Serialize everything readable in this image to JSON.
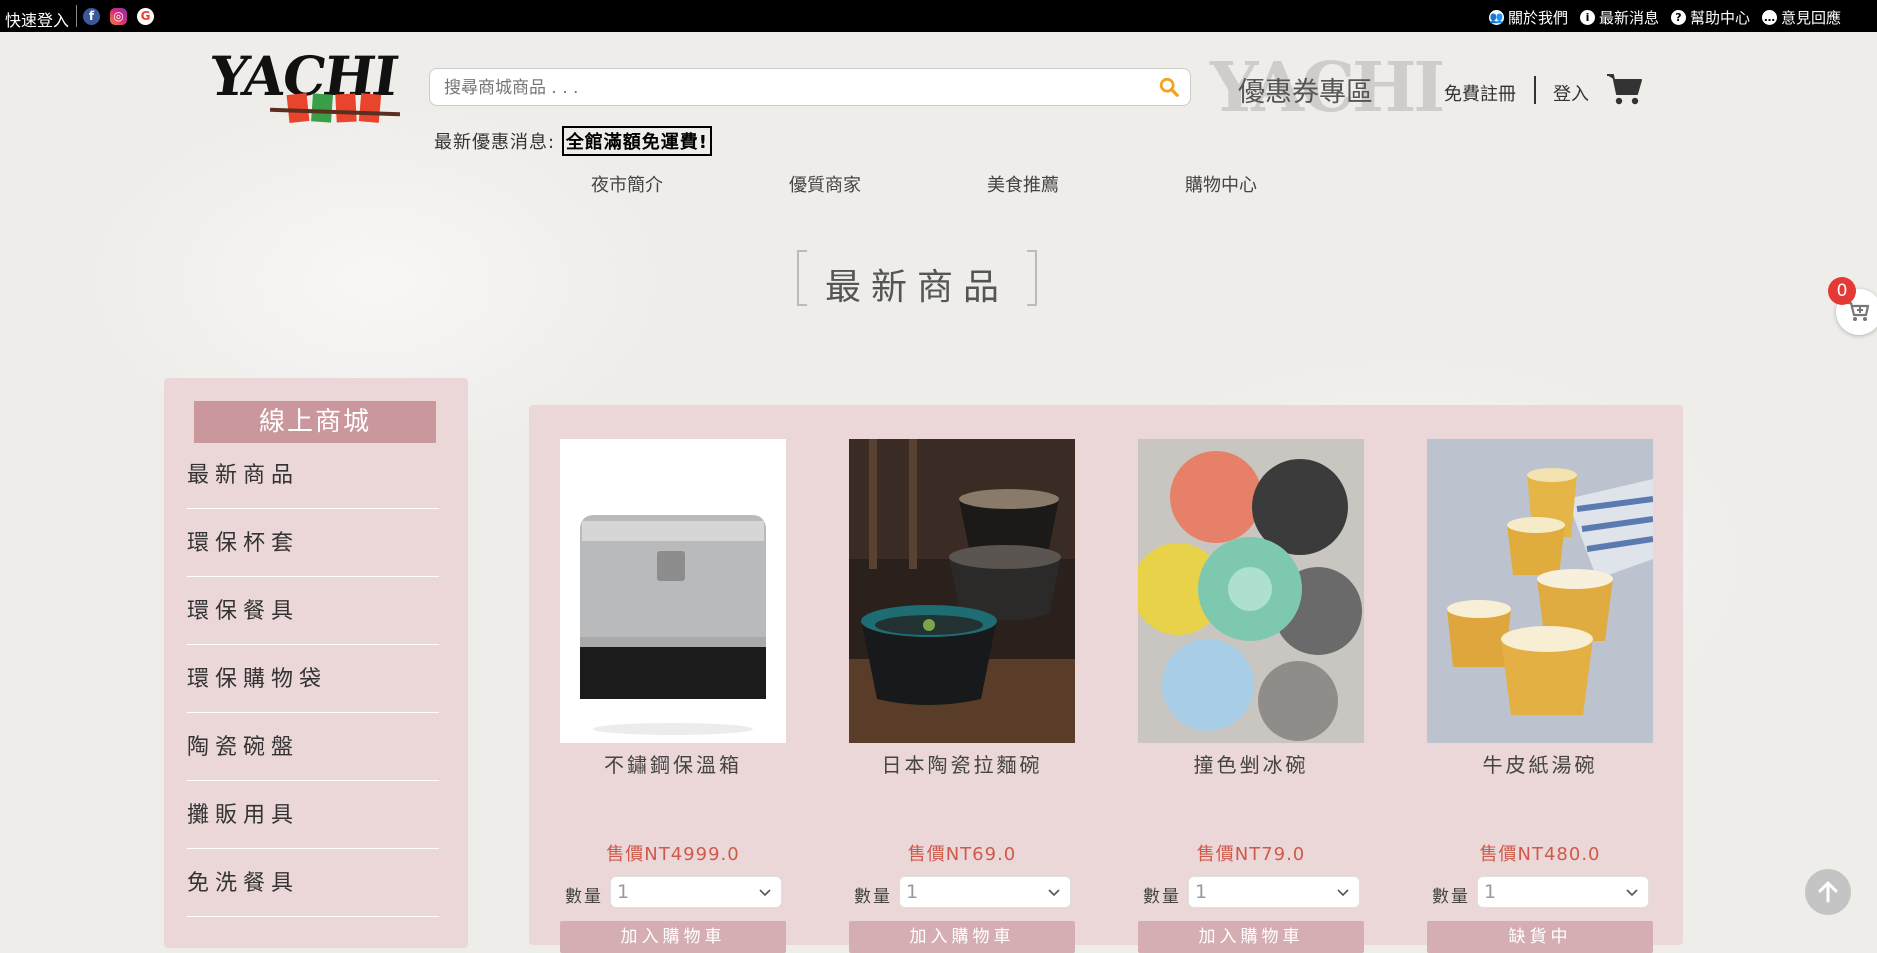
{
  "topbar": {
    "quick_login": "快速登入",
    "links": [
      {
        "label": "關於我們",
        "icon": "users-icon"
      },
      {
        "label": "最新消息",
        "icon": "info-icon"
      },
      {
        "label": "幫助中心",
        "icon": "help-icon"
      },
      {
        "label": "意見回應",
        "icon": "comment-icon"
      }
    ]
  },
  "header": {
    "logo_text": "YACHI",
    "search_placeholder": "搜尋商城商品 . . .",
    "coupon_label": "優惠券專區",
    "register": "免費註冊",
    "login": "登入",
    "promo_label": "最新優惠消息:",
    "promo_text": "全館滿額免運費!"
  },
  "nav": [
    "夜市簡介",
    "優質商家",
    "美食推薦",
    "購物中心"
  ],
  "section_title": "最新商品",
  "cart_count": "0",
  "sidebar": {
    "title": "線上商城",
    "items": [
      "最新商品",
      "環保杯套",
      "環保餐具",
      "環保購物袋",
      "陶瓷碗盤",
      "攤販用具",
      "免洗餐具"
    ]
  },
  "products": [
    {
      "name": "不鏽鋼保溫箱",
      "price": "售價NT4999.0",
      "qty_label": "數量",
      "qty": "1",
      "button": "加入購物車"
    },
    {
      "name": "日本陶瓷拉麵碗",
      "price": "售價NT69.0",
      "qty_label": "數量",
      "qty": "1",
      "button": "加入購物車"
    },
    {
      "name": "撞色剉冰碗",
      "price": "售價NT79.0",
      "qty_label": "數量",
      "qty": "1",
      "button": "加入購物車"
    },
    {
      "name": "牛皮紙湯碗",
      "price": "售價NT480.0",
      "qty_label": "數量",
      "qty": "1",
      "button": "缺貨中"
    }
  ],
  "colors": {
    "topbar": "#000000",
    "panel": "#ebd7d8",
    "sidebar_head": "#c9979c",
    "button": "#d4aeb2",
    "price": "#cf5a4a",
    "badge": "#e53935"
  }
}
